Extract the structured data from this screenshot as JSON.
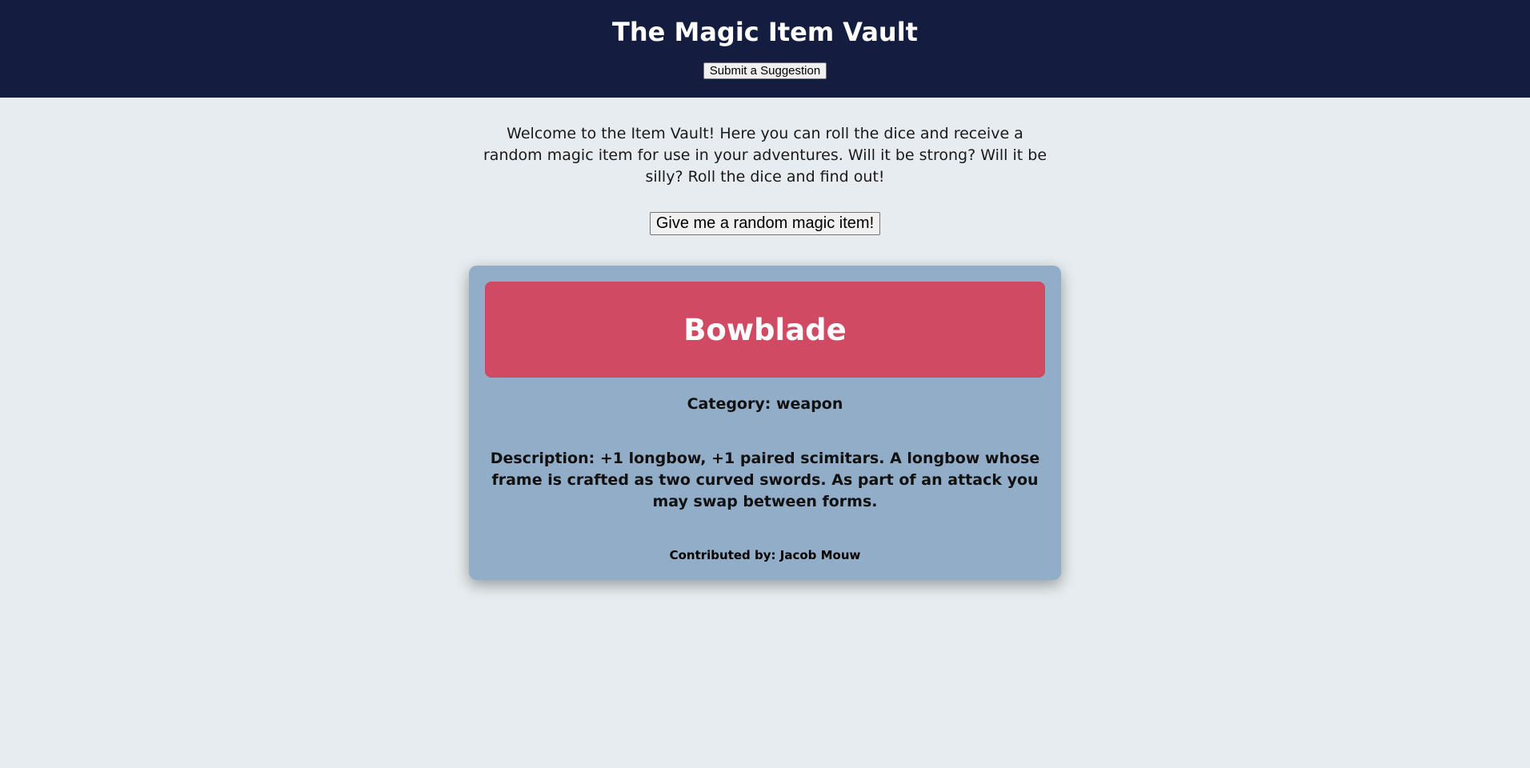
{
  "header": {
    "title": "The Magic Item Vault",
    "suggest_label": "Submit a Suggestion"
  },
  "intro": {
    "text": "Welcome to the Item Vault! Here you can roll the dice and receive a random magic item for use in your adventures. Will it be strong? Will it be silly? Roll the dice and find out!"
  },
  "roll": {
    "label": "Give me a random magic item!"
  },
  "item": {
    "name": "Bowblade",
    "category": "Category: weapon",
    "description": "Description: +1 longbow, +1 paired scimitars. A longbow whose frame is crafted as two curved swords. As part of an attack you may swap between forms.",
    "contributor": "Contributed by: Jacob Mouw"
  },
  "colors": {
    "header_bg": "#141d40",
    "page_bg": "#e6ecef",
    "card_bg": "#92adc8",
    "card_header_bg": "#cf4a62"
  }
}
